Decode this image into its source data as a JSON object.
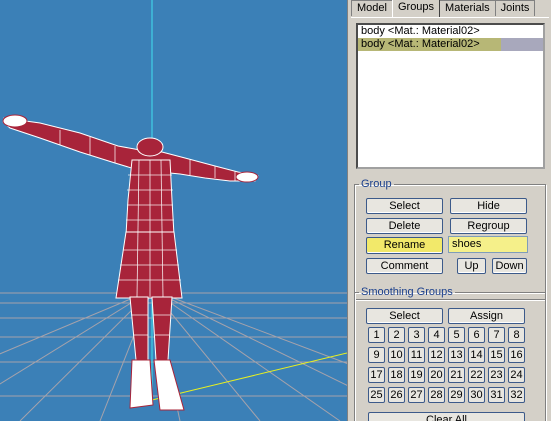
{
  "tabs": [
    "Model",
    "Groups",
    "Materials",
    "Joints"
  ],
  "active_tab": "Groups",
  "groups": [
    {
      "label": "body <Mat.: Material02>",
      "selected": false
    },
    {
      "label": "body <Mat.: Material02>",
      "selected": true
    }
  ],
  "group_section": {
    "title": "Group",
    "select": "Select",
    "hide": "Hide",
    "delete": "Delete",
    "regroup": "Regroup",
    "rename": "Rename",
    "rename_value": "shoes",
    "comment": "Comment",
    "up": "Up",
    "down": "Down"
  },
  "smoothing": {
    "title": "Smoothing Groups",
    "select": "Select",
    "assign": "Assign",
    "numbers": [
      "1",
      "2",
      "3",
      "4",
      "5",
      "6",
      "7",
      "8",
      "9",
      "10",
      "11",
      "12",
      "13",
      "14",
      "15",
      "16",
      "17",
      "18",
      "19",
      "20",
      "21",
      "22",
      "23",
      "24",
      "25",
      "26",
      "27",
      "28",
      "29",
      "30",
      "31",
      "32"
    ],
    "clear_all": "Clear All"
  },
  "colors": {
    "viewport_bg": "#3b80b7",
    "mesh_red": "#a8243a",
    "mesh_white": "#ffffff",
    "grid": "#b9a9a9",
    "axis_cyan": "#40e0f0",
    "axis_yellow": "#e8f020",
    "highlight": "#f2e96a"
  }
}
